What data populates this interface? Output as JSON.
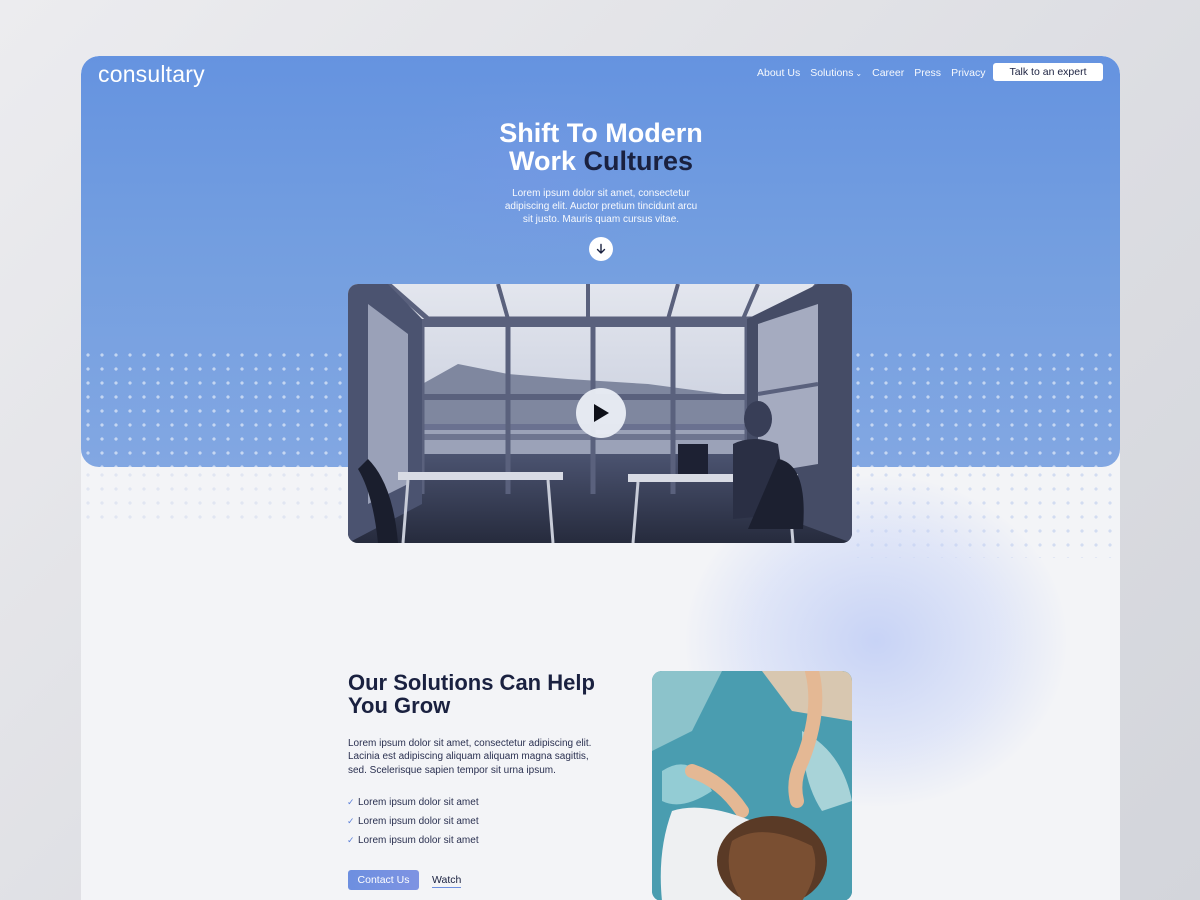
{
  "brand": {
    "name": "consultary"
  },
  "nav": {
    "items": [
      {
        "label": "About Us"
      },
      {
        "label": "Solutions",
        "dropdown": true
      },
      {
        "label": "Career"
      },
      {
        "label": "Press"
      },
      {
        "label": "Privacy"
      }
    ],
    "cta_label": "Talk to an expert"
  },
  "hero": {
    "title_line1": "Shift To Modern",
    "title_line2_light": "Work",
    "title_line2_dark": "Cultures",
    "description": "Lorem ipsum dolor sit amet, consectetur adipiscing elit. Auctor pretium tincidunt arcu sit justo. Mauris quam cursus vitae.",
    "scroll_icon": "arrow-down-icon"
  },
  "video": {
    "play_icon": "play-icon"
  },
  "solutions": {
    "title": "Our Solutions Can Help You Grow",
    "description": "Lorem ipsum dolor sit amet, consectetur adipiscing elit. Lacinia est adipiscing aliquam aliquam magna sagittis, sed. Scelerisque sapien tempor sit urna ipsum.",
    "checklist": [
      "Lorem ipsum dolor sit amet",
      "Lorem ipsum dolor sit amet",
      "Lorem ipsum dolor sit amet"
    ],
    "contact_label": "Contact Us",
    "watch_label": "Watch"
  },
  "colors": {
    "accent": "#6d8fe0",
    "hero_blue": "#6593e0",
    "dark_text": "#1a2140",
    "page_bg": "#f3f4f7"
  }
}
